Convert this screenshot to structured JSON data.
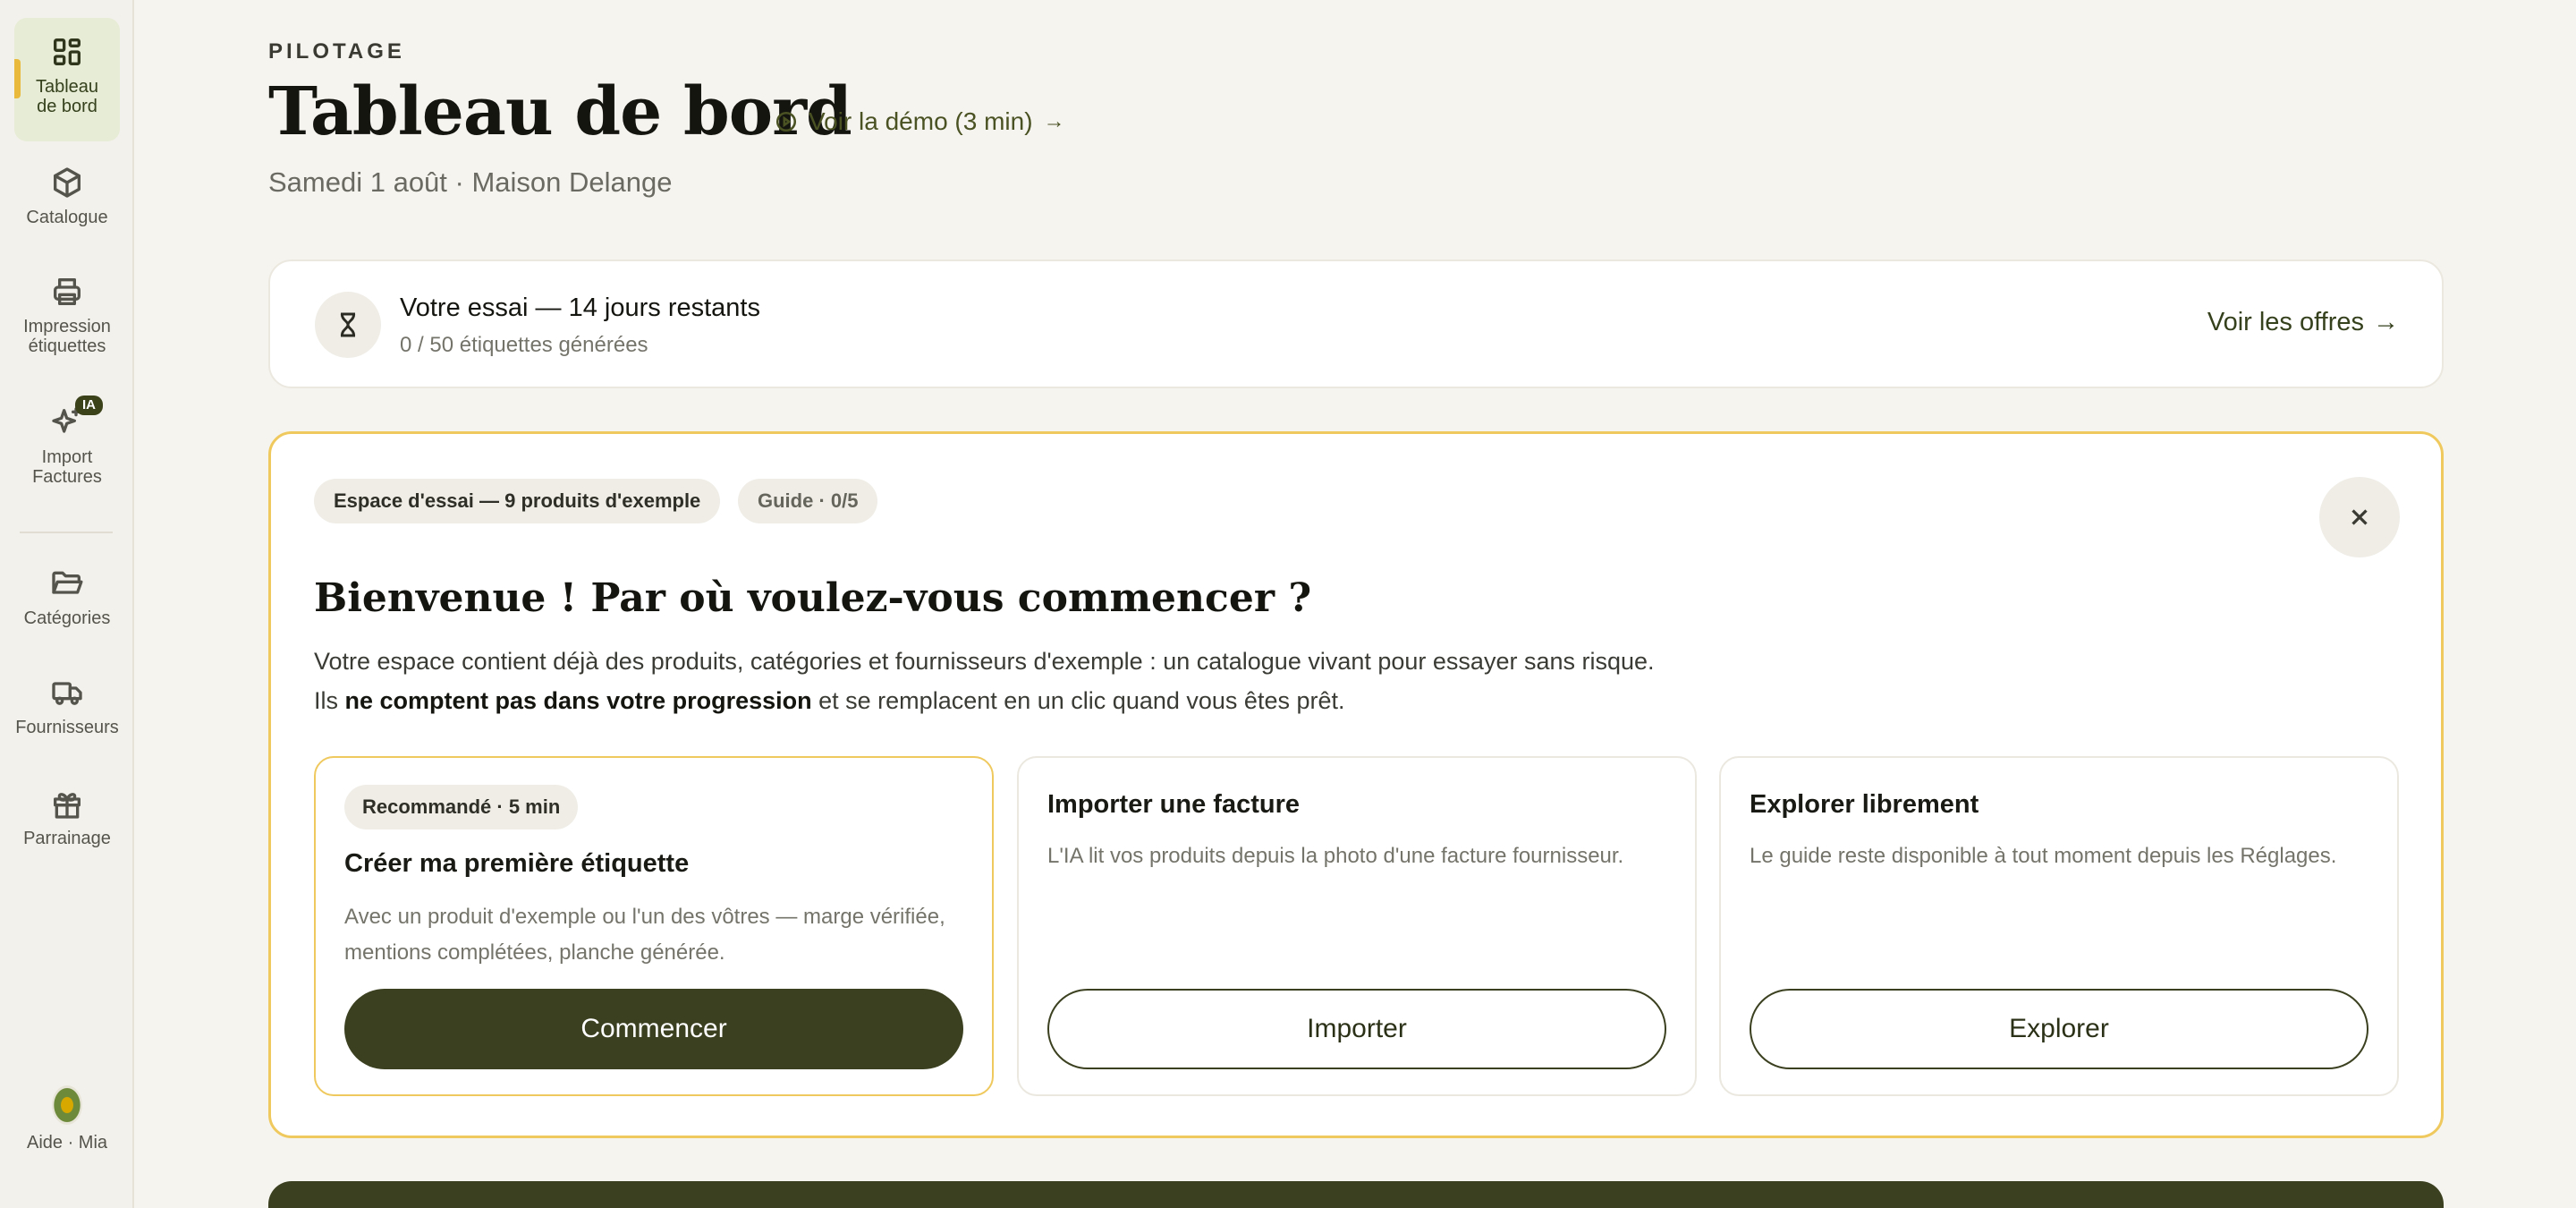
{
  "sidebar": {
    "items": [
      {
        "label": "Tableau\nde bord",
        "icon": "dashboard-icon"
      },
      {
        "label": "Catalogue",
        "icon": "box-icon"
      },
      {
        "label": "Impression\nétiquettes",
        "icon": "printer-icon"
      },
      {
        "label": "Import\nFactures",
        "icon": "sparkle-icon",
        "badge": "IA"
      },
      {
        "label": "Catégories",
        "icon": "folder-icon"
      },
      {
        "label": "Fournisseurs",
        "icon": "truck-icon"
      },
      {
        "label": "Parrainage",
        "icon": "gift-icon"
      }
    ],
    "help_label": "Aide · Mia"
  },
  "header": {
    "eyebrow": "PILOTAGE",
    "title": "Tableau de bord",
    "demo_link": "Voir la démo (3 min)",
    "subtitle": "Samedi 1 août · Maison Delange"
  },
  "trial": {
    "title": "Votre essai — 14 jours restants",
    "subtitle": "0 / 50 étiquettes générées",
    "offers_link": "Voir les offres"
  },
  "welcome": {
    "chip_sandbox": "Espace d'essai — 9 produits d'exemple",
    "chip_guide": "Guide · 0/5",
    "title": "Bienvenue ! Par où voulez-vous commencer ?",
    "desc_line1": "Votre espace contient déjà des produits, catégories et fournisseurs d'exemple : un catalogue vivant pour essayer sans risque.",
    "desc_line2_prefix": "Ils ",
    "desc_line2_bold": "ne comptent pas dans votre progression",
    "desc_line2_suffix": " et se remplacent en un clic quand vous êtes prêt.",
    "options": [
      {
        "badge": "Recommandé · 5 min",
        "title": "Créer ma première étiquette",
        "desc": "Avec un produit d'exemple ou l'un des vôtres — marge vérifiée, mentions complétées, planche générée.",
        "button": "Commencer"
      },
      {
        "title": "Importer une facture",
        "desc": "L'IA lit vos produits depuis la photo d'une facture fournisseur.",
        "button": "Importer"
      },
      {
        "title": "Explorer librement",
        "desc": "Le guide reste disponible à tout moment depuis les Réglages.",
        "button": "Explorer"
      }
    ]
  },
  "colors": {
    "accent_dark": "#3b4120",
    "highlight": "#efc95e",
    "background": "#f6f4ef"
  }
}
